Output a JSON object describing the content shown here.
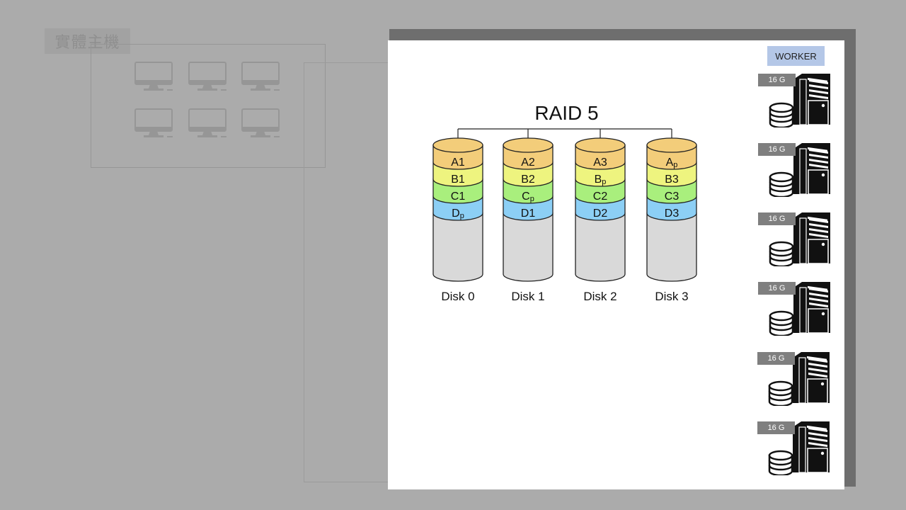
{
  "background": {
    "title": "實體主機",
    "monitors": [
      "monitor-1",
      "monitor-2",
      "monitor-3",
      "monitor-4",
      "monitor-5",
      "monitor-6"
    ]
  },
  "diagram": {
    "title": "RAID 5",
    "disks": [
      {
        "label": "Disk 0",
        "blocks": [
          {
            "main": "A",
            "sub": "1"
          },
          {
            "main": "B",
            "sub": "1"
          },
          {
            "main": "C",
            "sub": "1"
          },
          {
            "main": "D",
            "sub": "p"
          }
        ]
      },
      {
        "label": "Disk 1",
        "blocks": [
          {
            "main": "A",
            "sub": "2"
          },
          {
            "main": "B",
            "sub": "2"
          },
          {
            "main": "C",
            "sub": "p"
          },
          {
            "main": "D",
            "sub": "1"
          }
        ]
      },
      {
        "label": "Disk 2",
        "blocks": [
          {
            "main": "A",
            "sub": "3"
          },
          {
            "main": "B",
            "sub": "p"
          },
          {
            "main": "C",
            "sub": "2"
          },
          {
            "main": "D",
            "sub": "2"
          }
        ]
      },
      {
        "label": "Disk 3",
        "blocks": [
          {
            "main": "A",
            "sub": "p"
          },
          {
            "main": "B",
            "sub": "3"
          },
          {
            "main": "C",
            "sub": "3"
          },
          {
            "main": "D",
            "sub": "3"
          }
        ]
      }
    ],
    "block_colors": [
      "#f3cd7a",
      "#eef47f",
      "#a9ef7d",
      "#8ccff5"
    ],
    "empty_color": "#d9d9d9"
  },
  "sidebar": {
    "badge": "WORKER",
    "servers": [
      {
        "memory": "16 G"
      },
      {
        "memory": "16 G"
      },
      {
        "memory": "16 G"
      },
      {
        "memory": "16 G"
      },
      {
        "memory": "16 G"
      },
      {
        "memory": "16 G"
      }
    ]
  }
}
